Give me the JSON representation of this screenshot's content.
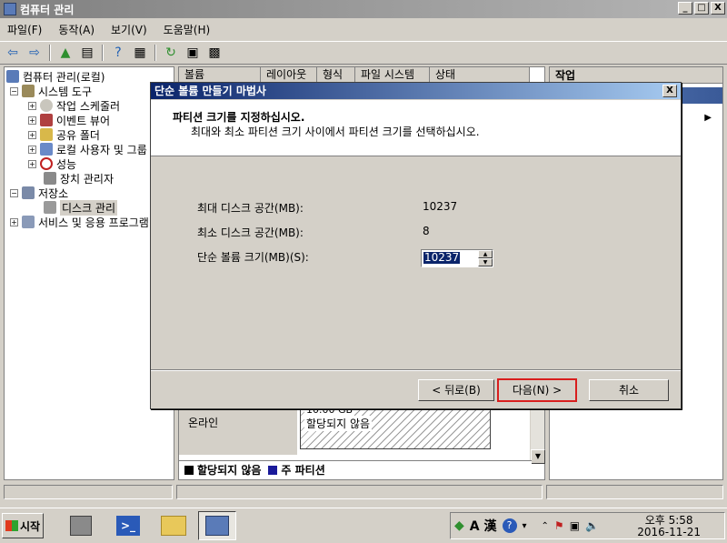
{
  "window": {
    "title": "컴퓨터 관리",
    "min_label": "_",
    "max_label": "□",
    "close_label": "X"
  },
  "menu": [
    "파일(F)",
    "동작(A)",
    "보기(V)",
    "도움말(H)"
  ],
  "tree": {
    "root": "컴퓨터 관리(로컬)",
    "system_tools": "시스템 도구",
    "task_scheduler": "작업 스케줄러",
    "event_viewer": "이벤트 뷰어",
    "shared_folders": "공유 폴더",
    "local_users": "로컬 사용자 및 그룹",
    "performance": "성능",
    "device_manager": "장치 관리자",
    "storage": "저장소",
    "disk_management": "디스크 관리",
    "services": "서비스 및 응용 프로그램"
  },
  "center": {
    "columns": [
      "볼륨",
      "레이아웃",
      "형식",
      "파일 시스템",
      "상태"
    ],
    "disk_status": "온라인",
    "partition_size": "10.00 GB",
    "partition_state": "할당되지 않음",
    "legend_unallocated": "할당되지 않음",
    "legend_primary": "주 파티션"
  },
  "actions": {
    "title": "작업"
  },
  "dialog": {
    "title": "단순 볼륨 만들기 마법사",
    "close_label": "X",
    "header_title": "파티션 크기를 지정하십시오.",
    "header_subtitle": "최대와 최소 파티션 크기 사이에서 파티션 크기를 선택하십시오.",
    "max_label": "최대 디스크 공간(MB):",
    "max_value": "10237",
    "min_label": "최소 디스크 공간(MB):",
    "min_value": "8",
    "size_label": "단순 볼륨 크기(MB)(S):",
    "size_value": "10237",
    "back_button": "< 뒤로(B)",
    "next_button": "다음(N) >",
    "cancel_button": "취소"
  },
  "taskbar": {
    "start_label": "시작",
    "ime_label": "A 漢",
    "time": "오후 5:58",
    "date": "2016-11-21"
  }
}
